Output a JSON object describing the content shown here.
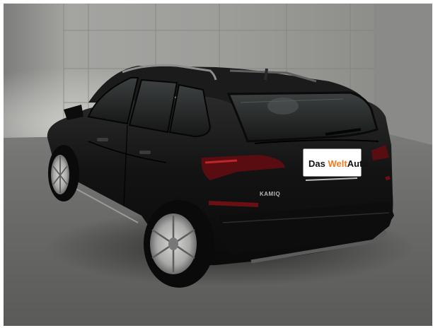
{
  "photo": {
    "plate_text": {
      "das": "Das ",
      "welt": "Welt",
      "auto": "Auto"
    },
    "badge_text": "KAMIQ",
    "colors": {
      "wall": "#9a9a97",
      "floor": "#666664",
      "car_body": "#121312",
      "accent": "#f07b1c"
    }
  }
}
